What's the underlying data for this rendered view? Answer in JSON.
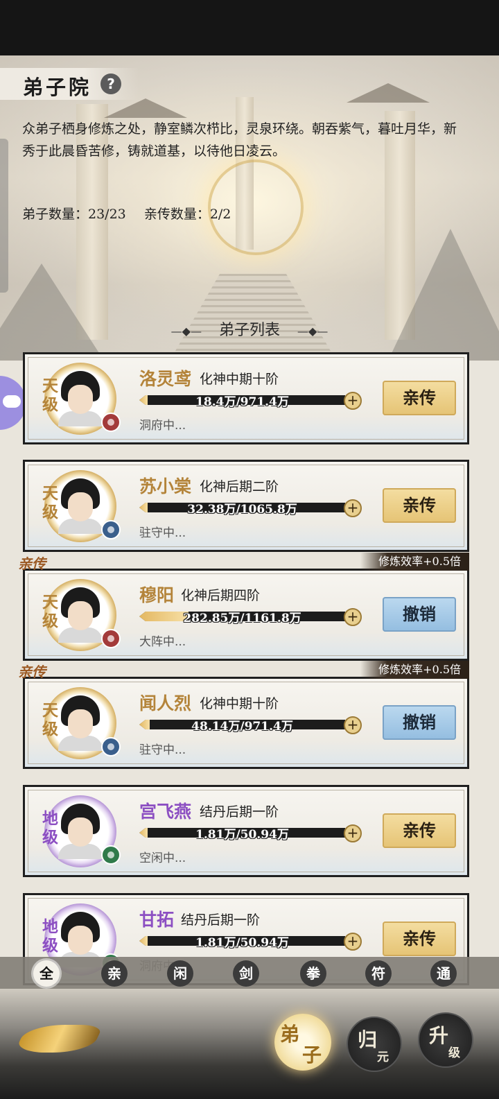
{
  "header": {
    "title": "弟子院",
    "help_icon": "?",
    "description": "众弟子栖身修炼之处，静室鳞次栉比，灵泉环绕。朝吞紫气，暮吐月华，新秀于此晨昏苦修，铸就道基，以待他日凌云。",
    "disciple_count": "弟子数量：23/23",
    "direct_count": "亲传数量：2/2",
    "list_title": "弟子列表",
    "ornament_left": "—◆—",
    "ornament_right": "—◆—"
  },
  "disciples": [
    {
      "name": "洛灵鸢",
      "realm": "化神中期十阶",
      "grade": "天级",
      "exp": "18.4万/971.4万",
      "progress": 0.02,
      "status": "洞府中...",
      "action": "亲传",
      "element": "red",
      "is_direct": false,
      "efficiency": ""
    },
    {
      "name": "苏小棠",
      "realm": "化神后期二阶",
      "grade": "天级",
      "exp": "32.38万/1065.8万",
      "progress": 0.03,
      "status": "驻守中...",
      "action": "亲传",
      "element": "blue",
      "is_direct": false,
      "efficiency": ""
    },
    {
      "name": "穆阳",
      "realm": "化神后期四阶",
      "grade": "天级",
      "exp": "282.85万/1161.8万",
      "progress": 0.24,
      "status": "大阵中...",
      "action": "撤销",
      "element": "red",
      "is_direct": true,
      "direct_tag": "亲传",
      "efficiency": "修炼效率+0.5倍"
    },
    {
      "name": "闻人烈",
      "realm": "化神中期十阶",
      "grade": "天级",
      "exp": "48.14万/971.4万",
      "progress": 0.05,
      "status": "驻守中...",
      "action": "撤销",
      "element": "blue",
      "is_direct": true,
      "direct_tag": "亲传",
      "efficiency": "修炼效率+0.5倍"
    },
    {
      "name": "宫飞燕",
      "realm": "结丹后期一阶",
      "grade": "地级",
      "exp": "1.81万/50.94万",
      "progress": 0.04,
      "status": "空闲中...",
      "action": "亲传",
      "element": "green",
      "is_direct": false,
      "efficiency": ""
    },
    {
      "name": "甘拓",
      "realm": "结丹后期一阶",
      "grade": "地级",
      "exp": "1.81万/50.94万",
      "progress": 0.04,
      "status": "洞府中...",
      "action": "亲传",
      "element": "green",
      "is_direct": false,
      "efficiency": ""
    }
  ],
  "filters": [
    "全",
    "亲",
    "闲",
    "剑",
    "拳",
    "符",
    "通"
  ],
  "bottom_nav": {
    "disciples_a": "弟",
    "disciples_b": "子",
    "return_a": "归",
    "return_b": "元",
    "upgrade_a": "升",
    "upgrade_b": "级"
  },
  "colors": {
    "gold_grade": "#b4843a",
    "purple_grade": "#8c4fc2",
    "accent": "#e5c374"
  }
}
